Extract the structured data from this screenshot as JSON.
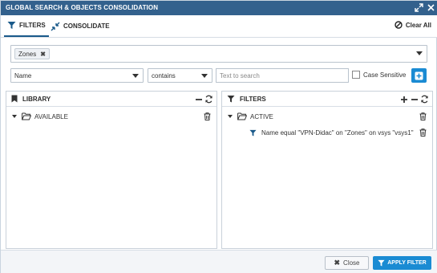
{
  "window": {
    "title": "GLOBAL SEARCH & OBJECTS CONSOLIDATION"
  },
  "tabs": [
    {
      "label": "FILTERS",
      "icon": "filter-icon",
      "active": true
    },
    {
      "label": "CONSOLIDATE",
      "icon": "compress-arrows-icon",
      "active": false
    }
  ],
  "clear_all": {
    "label": "Clear All",
    "icon": "ban-icon"
  },
  "zones_field": {
    "chip": "Zones"
  },
  "filter_row": {
    "field": "Name",
    "operator": "contains",
    "search_placeholder": "Text to search",
    "search_value": "",
    "case_sensitive_label": "Case Sensitive",
    "case_sensitive_checked": false
  },
  "library": {
    "header": "LIBRARY",
    "folder": "AVAILABLE"
  },
  "filters_panel": {
    "header": "FILTERS",
    "folder": "ACTIVE",
    "items": [
      {
        "text": "Name equal \"VPN-Didac\" on \"Zones\" on vsys \"vsys1\""
      }
    ]
  },
  "footer": {
    "close_label": "Close",
    "apply_label": "APPLY FILTER"
  },
  "colors": {
    "titlebar": "#33618d",
    "accent_button": "#1a8bd3",
    "tab_underline": "#1a5a8a"
  }
}
